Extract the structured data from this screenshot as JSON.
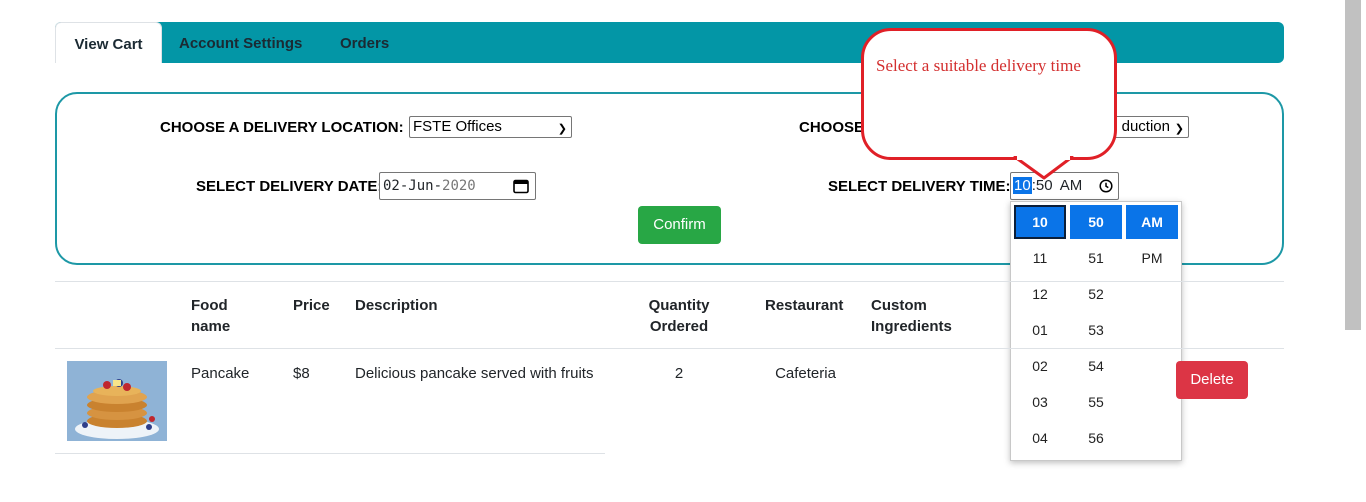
{
  "tabs": [
    "View Cart",
    "Account Settings",
    "Orders"
  ],
  "form": {
    "location_label": "CHOOSE A DELIVERY LOCATION:",
    "location_value": "FSTE Offices",
    "choose_label_partial": "CHOOSE",
    "second_select_partial": "duction",
    "date_label": "SELECT DELIVERY DATE:",
    "date_value_day": "02-Jun-",
    "date_value_year": "2020",
    "time_label": "SELECT DELIVERY TIME:",
    "time_hour": "10",
    "time_sep": ":",
    "time_minute": "50",
    "time_ampm": "AM",
    "confirm_label": "Confirm"
  },
  "callout": {
    "text": "Select a suitable delivery time"
  },
  "time_picker": {
    "hours": [
      "10",
      "11",
      "12",
      "01",
      "02",
      "03",
      "04"
    ],
    "minutes": [
      "50",
      "51",
      "52",
      "53",
      "54",
      "55",
      "56"
    ],
    "periods": [
      "AM",
      "PM"
    ],
    "selected": {
      "hour": "10",
      "minute": "50",
      "period": "AM"
    }
  },
  "table": {
    "headers": {
      "food_name": "Food name",
      "price": "Price",
      "description": "Description",
      "quantity": "Quantity Ordered",
      "restaurant": "Restaurant",
      "custom": "Custom Ingredients"
    },
    "rows": [
      {
        "food_name": "Pancake",
        "price": "$8",
        "description": "Delicious pancake served with fruits",
        "quantity": "2",
        "restaurant": "Cafeteria",
        "delete_label": "Delete"
      }
    ]
  },
  "colors": {
    "tab_bar": "#0396a6",
    "confirm": "#28a745",
    "delete": "#dc3545",
    "callout_border": "#e02027",
    "selected_time": "#0a74e8"
  },
  "icons": {
    "calendar": "calendar-icon",
    "clock": "clock-icon",
    "select": "chevron-down-icon"
  }
}
